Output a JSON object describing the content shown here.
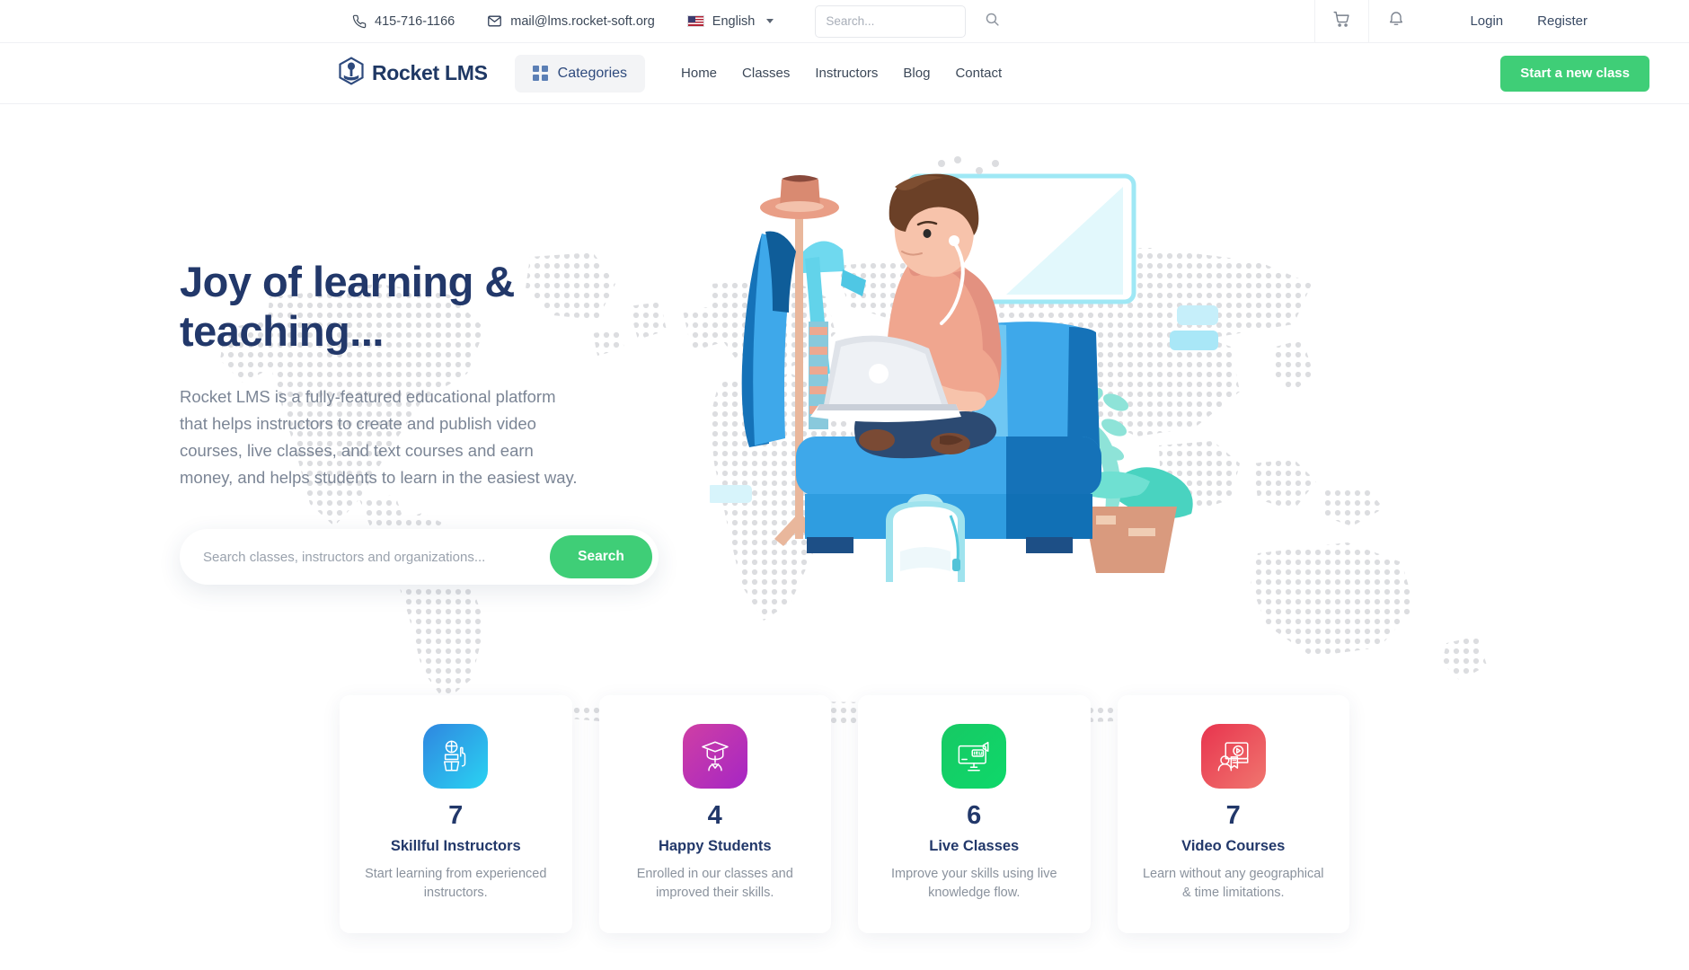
{
  "topbar": {
    "phone": "415-716-1166",
    "email": "mail@lms.rocket-soft.org",
    "language": "English",
    "search_placeholder": "Search...",
    "search_value": "",
    "login": "Login",
    "register": "Register",
    "icons": {
      "phone": "phone-icon",
      "mail": "envelope-icon",
      "flag": "us-flag-icon",
      "search": "search-icon",
      "cart": "cart-icon",
      "bell": "bell-icon"
    }
  },
  "navbar": {
    "brand": "Rocket LMS",
    "categories_label": "Categories",
    "links": [
      "Home",
      "Classes",
      "Instructors",
      "Blog",
      "Contact"
    ],
    "cta": "Start a new class",
    "cta_color": "#3fce77"
  },
  "hero": {
    "title": "Joy of learning &\nteaching...",
    "subtitle": "Rocket LMS is a fully-featured educational platform\nthat helps instructors to create and publish video\ncourses, live classes, and text courses and earn\nmoney, and helps students to learn in the easiest way.",
    "search_placeholder": "Search classes, instructors and organizations...",
    "search_value": "",
    "search_button": "Search",
    "illustration": "student-on-couch-with-laptop-illustration",
    "background": "dotted-world-map"
  },
  "stats": [
    {
      "count": "7",
      "title": "Skillful Instructors",
      "desc": "Start learning from experienced instructors.",
      "icon": "instructor-icon",
      "color_start": "#2f86e0",
      "color_end": "#2ad3f2"
    },
    {
      "count": "4",
      "title": "Happy Students",
      "desc": "Enrolled in our classes and improved their skills.",
      "icon": "graduate-icon",
      "color_start": "#cf3fa4",
      "color_end": "#a626c4"
    },
    {
      "count": "6",
      "title": "Live Classes",
      "desc": "Improve your skills using live knowledge flow.",
      "icon": "live-monitor-icon",
      "color_start": "#17c964",
      "color_end": "#0ed86a"
    },
    {
      "count": "7",
      "title": "Video Courses",
      "desc": "Learn without any geographical & time limitations.",
      "icon": "video-course-icon",
      "color_start": "#e8344e",
      "color_end": "#f0766f"
    }
  ],
  "colors": {
    "brand_navy": "#22386a",
    "accent_green": "#3fce77",
    "text_muted": "#8a929d"
  }
}
